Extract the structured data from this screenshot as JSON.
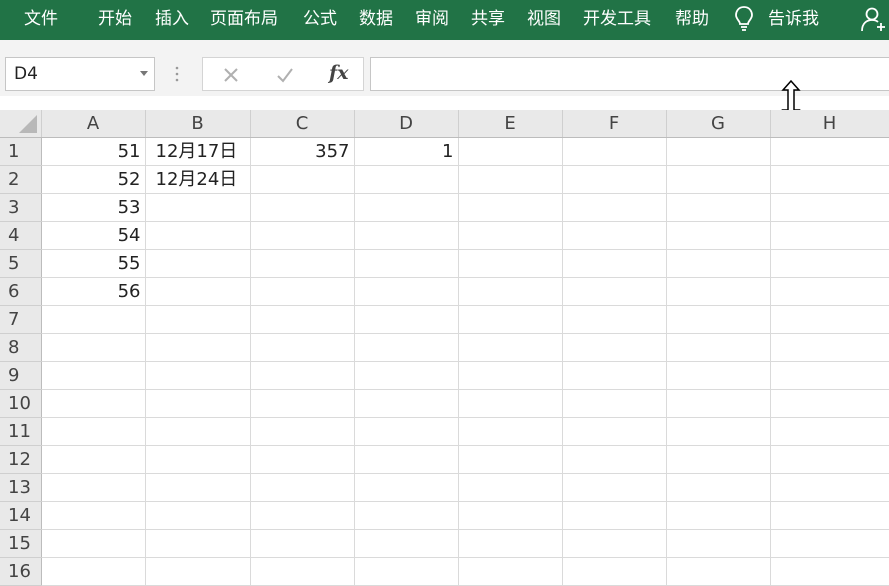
{
  "ribbon": {
    "tabs": [
      "文件",
      "开始",
      "插入",
      "页面布局",
      "公式",
      "数据",
      "审阅",
      "共享",
      "视图",
      "开发工具",
      "帮助"
    ],
    "tell_me": "告诉我"
  },
  "formula_bar": {
    "name_box": "D4",
    "formula": ""
  },
  "grid": {
    "columns": [
      "A",
      "B",
      "C",
      "D",
      "E",
      "F",
      "G",
      "H"
    ],
    "rows": [
      {
        "num": "1",
        "cells": [
          "51",
          "12月17日",
          "357",
          "1",
          "",
          "",
          "",
          ""
        ]
      },
      {
        "num": "2",
        "cells": [
          "52",
          "12月24日",
          "",
          "",
          "",
          "",
          "",
          ""
        ]
      },
      {
        "num": "3",
        "cells": [
          "53",
          "",
          "",
          "",
          "",
          "",
          "",
          ""
        ]
      },
      {
        "num": "4",
        "cells": [
          "54",
          "",
          "",
          "",
          "",
          "",
          "",
          ""
        ]
      },
      {
        "num": "5",
        "cells": [
          "55",
          "",
          "",
          "",
          "",
          "",
          "",
          ""
        ]
      },
      {
        "num": "6",
        "cells": [
          "56",
          "",
          "",
          "",
          "",
          "",
          "",
          ""
        ]
      },
      {
        "num": "7",
        "cells": [
          "",
          "",
          "",
          "",
          "",
          "",
          "",
          ""
        ]
      },
      {
        "num": "8",
        "cells": [
          "",
          "",
          "",
          "",
          "",
          "",
          "",
          ""
        ]
      },
      {
        "num": "9",
        "cells": [
          "",
          "",
          "",
          "",
          "",
          "",
          "",
          ""
        ]
      },
      {
        "num": "10",
        "cells": [
          "",
          "",
          "",
          "",
          "",
          "",
          "",
          ""
        ]
      },
      {
        "num": "11",
        "cells": [
          "",
          "",
          "",
          "",
          "",
          "",
          "",
          ""
        ]
      },
      {
        "num": "12",
        "cells": [
          "",
          "",
          "",
          "",
          "",
          "",
          "",
          ""
        ]
      },
      {
        "num": "13",
        "cells": [
          "",
          "",
          "",
          "",
          "",
          "",
          "",
          ""
        ]
      },
      {
        "num": "14",
        "cells": [
          "",
          "",
          "",
          "",
          "",
          "",
          "",
          ""
        ]
      },
      {
        "num": "15",
        "cells": [
          "",
          "",
          "",
          "",
          "",
          "",
          "",
          ""
        ]
      }
    ],
    "partial_row": "16"
  },
  "colors": {
    "ribbon": "#217346",
    "header_bg": "#e9e9e9",
    "gridline": "#dadada"
  }
}
